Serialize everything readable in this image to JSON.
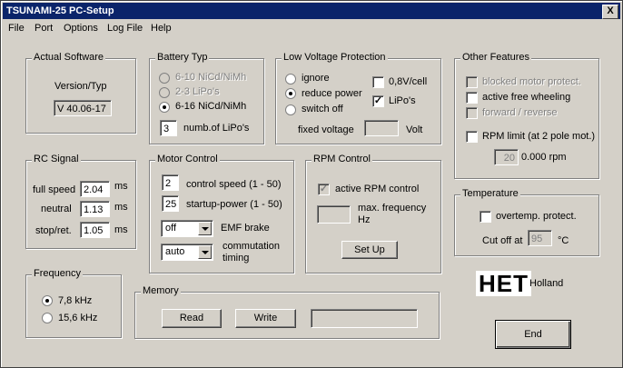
{
  "window": {
    "title": "TSUNAMI-25  PC-Setup",
    "close": "X"
  },
  "menu": [
    "File",
    "Port",
    "Options",
    "Log File",
    "Help"
  ],
  "actual_software": {
    "legend": "Actual Software",
    "label": "Version/Typ",
    "value": "V 40.06-17"
  },
  "battery": {
    "legend": "Battery Typ",
    "options": [
      "6-10 NiCd/NiMh",
      "2-3 LiPo's",
      "6-16 NiCd/NiMh"
    ],
    "selected": 2,
    "lipo_count": "3",
    "lipo_label": "numb.of LiPo's"
  },
  "low_voltage": {
    "legend": "Low Voltage Protection",
    "options": [
      "ignore",
      "reduce power",
      "switch off"
    ],
    "selected": 1,
    "cell_label": "0,8V/cell",
    "lipo_label": "LiPo's",
    "fixed_label": "fixed voltage",
    "fixed_value": "",
    "unit": "Volt"
  },
  "other": {
    "legend": "Other Features",
    "blocked": "blocked motor protect.",
    "freewheel": "active free wheeling",
    "fwdrev": "forward / reverse",
    "rpm_limit": "RPM limit (at 2 pole mot.)",
    "rpm_value": "20",
    "rpm_text": "0.000 rpm"
  },
  "rc_signal": {
    "legend": "RC Signal",
    "unit": "ms",
    "rows": [
      {
        "label": "full speed",
        "value": "2.04"
      },
      {
        "label": "neutral",
        "value": "1.13"
      },
      {
        "label": "stop/ret.",
        "value": "1.05"
      }
    ]
  },
  "motor": {
    "legend": "Motor Control",
    "control_speed": "2",
    "control_speed_label": "control speed (1 - 50)",
    "startup": "25",
    "startup_label": "startup-power (1 - 50)",
    "emf": "off",
    "emf_label": "EMF brake",
    "commutation": "auto",
    "commutation_label": "commutation timing"
  },
  "rpm": {
    "legend": "RPM Control",
    "active": "active RPM control",
    "max_freq_label": "max. frequency Hz",
    "max_freq": "",
    "setup": "Set Up"
  },
  "temperature": {
    "legend": "Temperature",
    "overtemp": "overtemp. protect.",
    "cutoff_label": "Cut off at",
    "cutoff_value": "95",
    "unit": "°C"
  },
  "frequency": {
    "legend": "Frequency",
    "options": [
      "7,8 kHz",
      "15,6 kHz"
    ],
    "selected": 0
  },
  "memory": {
    "legend": "Memory",
    "read": "Read",
    "write": "Write",
    "status": ""
  },
  "brand": {
    "logo": "HET",
    "country": "Holland"
  },
  "end_button": "End"
}
